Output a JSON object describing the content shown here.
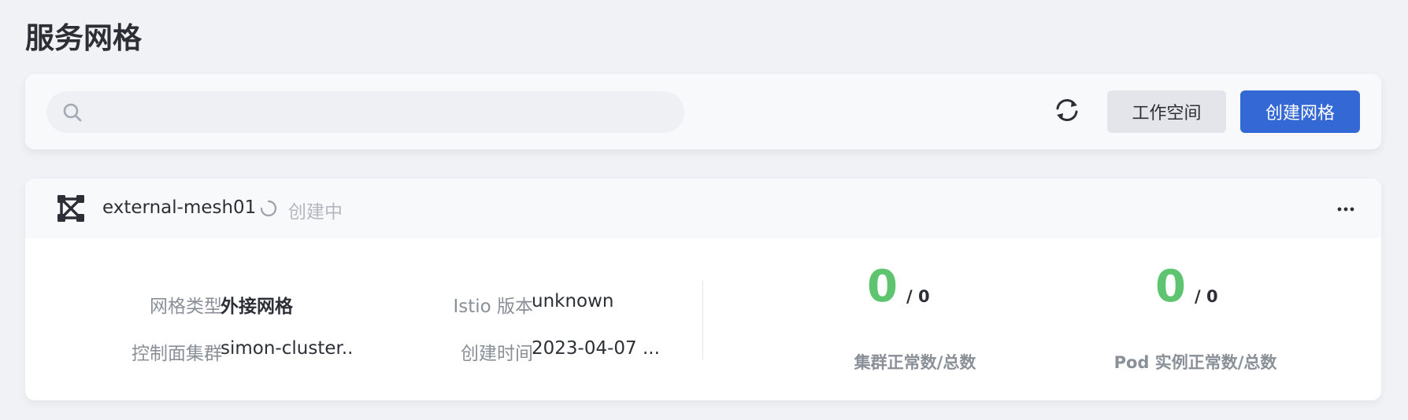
{
  "page": {
    "title": "服务网格"
  },
  "toolbar": {
    "search": {
      "value": "",
      "placeholder": ""
    },
    "workspace_button": "工作空间",
    "create_button": "创建网格"
  },
  "mesh": {
    "name": "external-mesh01",
    "status": "创建中",
    "fields": {
      "mesh_type_label": "网格类型",
      "mesh_type_value": "外接网格",
      "istio_version_label": "Istio 版本",
      "istio_version_value": "unknown",
      "control_cluster_label": "控制面集群",
      "control_cluster_value": "simon-cluster...",
      "created_time_label": "创建时间",
      "created_time_value": "2023-04-07 ..."
    },
    "stats": {
      "cluster_healthy": "0",
      "cluster_total": "/ 0",
      "cluster_label": "集群正常数/总数",
      "pod_healthy": "0",
      "pod_total": "/ 0",
      "pod_label": "Pod 实例正常数/总数"
    }
  },
  "colors": {
    "primary": "#3468d4",
    "success": "#5fc46f",
    "muted_text": "#8a9098",
    "background": "#f1f2f5"
  },
  "icons": [
    "search-icon",
    "refresh-icon",
    "mesh-icon",
    "loading-spinner-icon",
    "more-icon"
  ]
}
